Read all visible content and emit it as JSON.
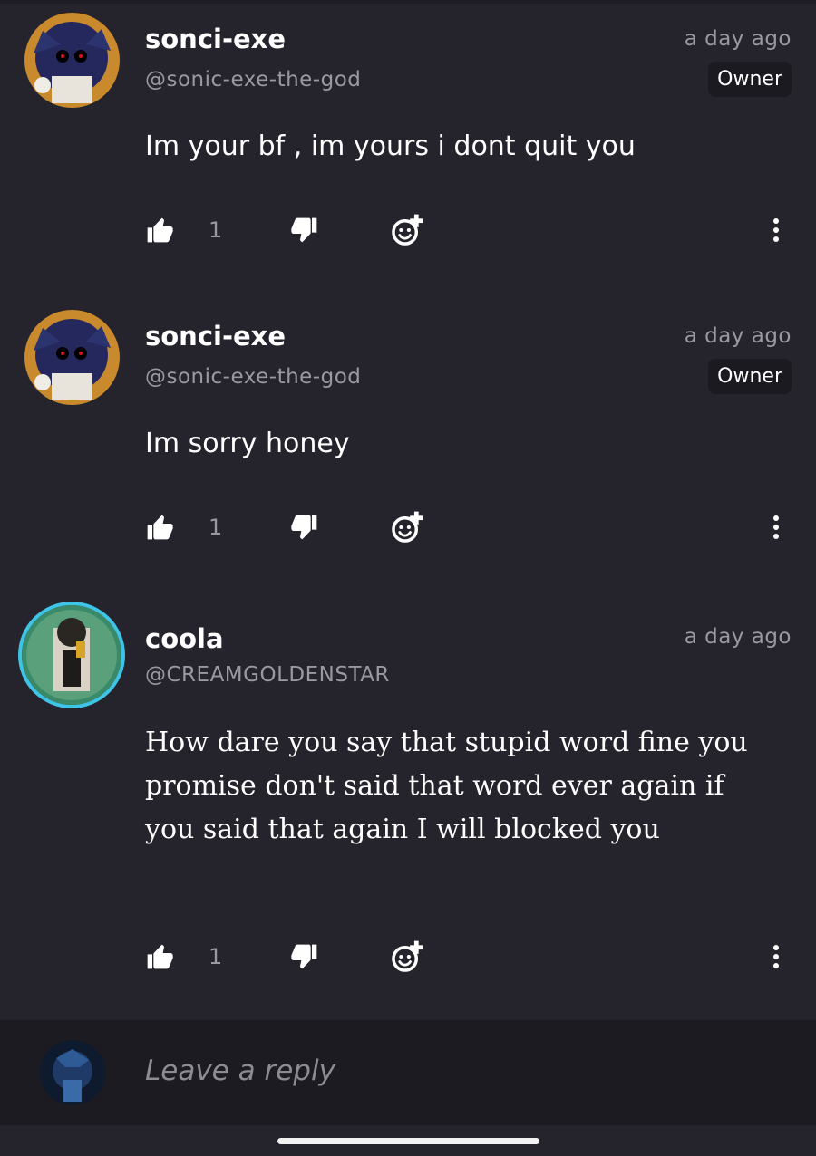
{
  "comments": [
    {
      "username": "sonci-exe",
      "handle": "@sonic-exe-the-god",
      "timestamp": "a day ago",
      "badge": "Owner",
      "body": "Im your bf , im yours i dont quit you",
      "likes": "1",
      "avatar_icon": "sonic-exe-avatar"
    },
    {
      "username": "sonci-exe",
      "handle": "@sonic-exe-the-god",
      "timestamp": "a day ago",
      "badge": "Owner",
      "body": "Im sorry honey",
      "likes": "1",
      "avatar_icon": "sonic-exe-avatar"
    },
    {
      "username": "coola",
      "handle": "@CREAMGOLDENSTAR",
      "timestamp": "a day ago",
      "body": "How dare you say that stupid word fine you promise don't said that word ever again if you said that again I will blocked you",
      "likes": "1",
      "avatar_icon": "coola-avatar"
    }
  ],
  "reply": {
    "placeholder": "Leave a reply"
  },
  "colors": {
    "background": "#25232c",
    "reply_bar": "#1c1b21",
    "muted_text": "#9a98a0",
    "badge_bg": "#1b1a20",
    "avatar_ring": "#3fc4e6"
  },
  "icons": [
    "thumbs-up-icon",
    "thumbs-down-icon",
    "add-reaction-icon",
    "more-vertical-icon"
  ]
}
